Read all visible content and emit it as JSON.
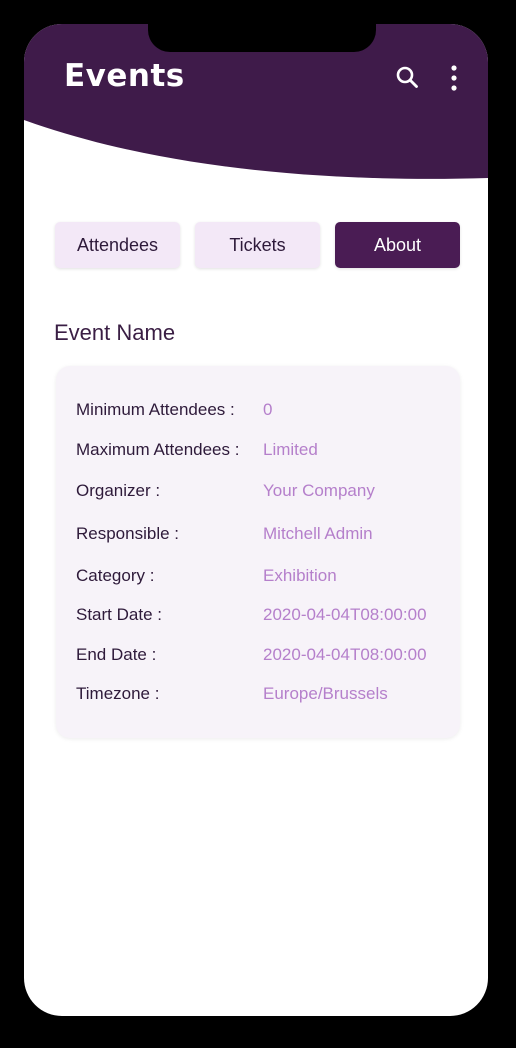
{
  "app": {
    "title": "Events"
  },
  "header": {
    "search_icon": "search-icon",
    "menu_icon": "more-vertical-icon"
  },
  "tabs": [
    {
      "label": "Attendees",
      "active": false
    },
    {
      "label": "Tickets",
      "active": false
    },
    {
      "label": "About",
      "active": true
    }
  ],
  "event": {
    "section_title": "Event Name",
    "details": [
      {
        "label": "Minimum Attendees :",
        "value": "0"
      },
      {
        "label": "Maximum Attendees :",
        "value": "Limited"
      },
      {
        "label": "Organizer :",
        "value": "Your Company"
      },
      {
        "label": "Responsible :",
        "value": "Mitchell Admin"
      },
      {
        "label": "Category :",
        "value": "Exhibition"
      },
      {
        "label": "Start Date :",
        "value": "2020-04-04T08:00:00"
      },
      {
        "label": "End Date :",
        "value": "2020-04-04T08:00:00"
      },
      {
        "label": "Timezone :",
        "value": "Europe/Brussels"
      }
    ]
  },
  "colors": {
    "header": "#3f1b4a",
    "accent": "#4a1c54",
    "tab_inactive": "#f3e8f7",
    "value_text": "#b57fcb",
    "label_text": "#2e1a3a"
  }
}
